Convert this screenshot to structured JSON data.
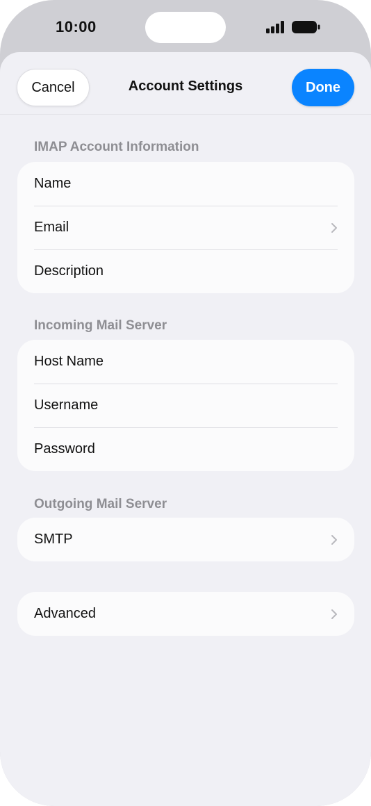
{
  "status_bar": {
    "time": "10:00"
  },
  "navbar": {
    "cancel_label": "Cancel",
    "title": "Account Settings",
    "done_label": "Done"
  },
  "sections": {
    "imap": {
      "header": "IMAP Account Information",
      "rows": [
        "Name",
        "Email",
        "Description"
      ]
    },
    "incoming": {
      "header": "Incoming Mail Server",
      "rows": [
        "Host Name",
        "Username",
        "Password"
      ]
    },
    "outgoing": {
      "header": "Outgoing Mail Server",
      "rows": [
        "SMTP"
      ]
    },
    "advanced": {
      "rows": [
        "Advanced"
      ]
    }
  },
  "colors": {
    "accent": "#0a84ff",
    "background": "#f0f0f5",
    "secondary_text": "#8e8e93"
  },
  "icons": [
    "signal-icon",
    "battery-icon",
    "chevron-right-icon"
  ]
}
